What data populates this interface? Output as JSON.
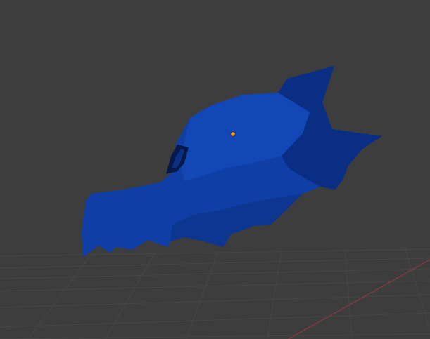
{
  "viewport": {
    "background_color": "#3d3d3d",
    "grid_line_color": "#474747",
    "x_axis_color": "#8a3b3f"
  },
  "mesh": {
    "material_color": "#0f3ea6",
    "shadow_color": "#0a2a78",
    "highlight_color": "#1a4fc2",
    "hole_color": "#061a4a"
  },
  "origin_point": {
    "color": "#f2a33a"
  }
}
